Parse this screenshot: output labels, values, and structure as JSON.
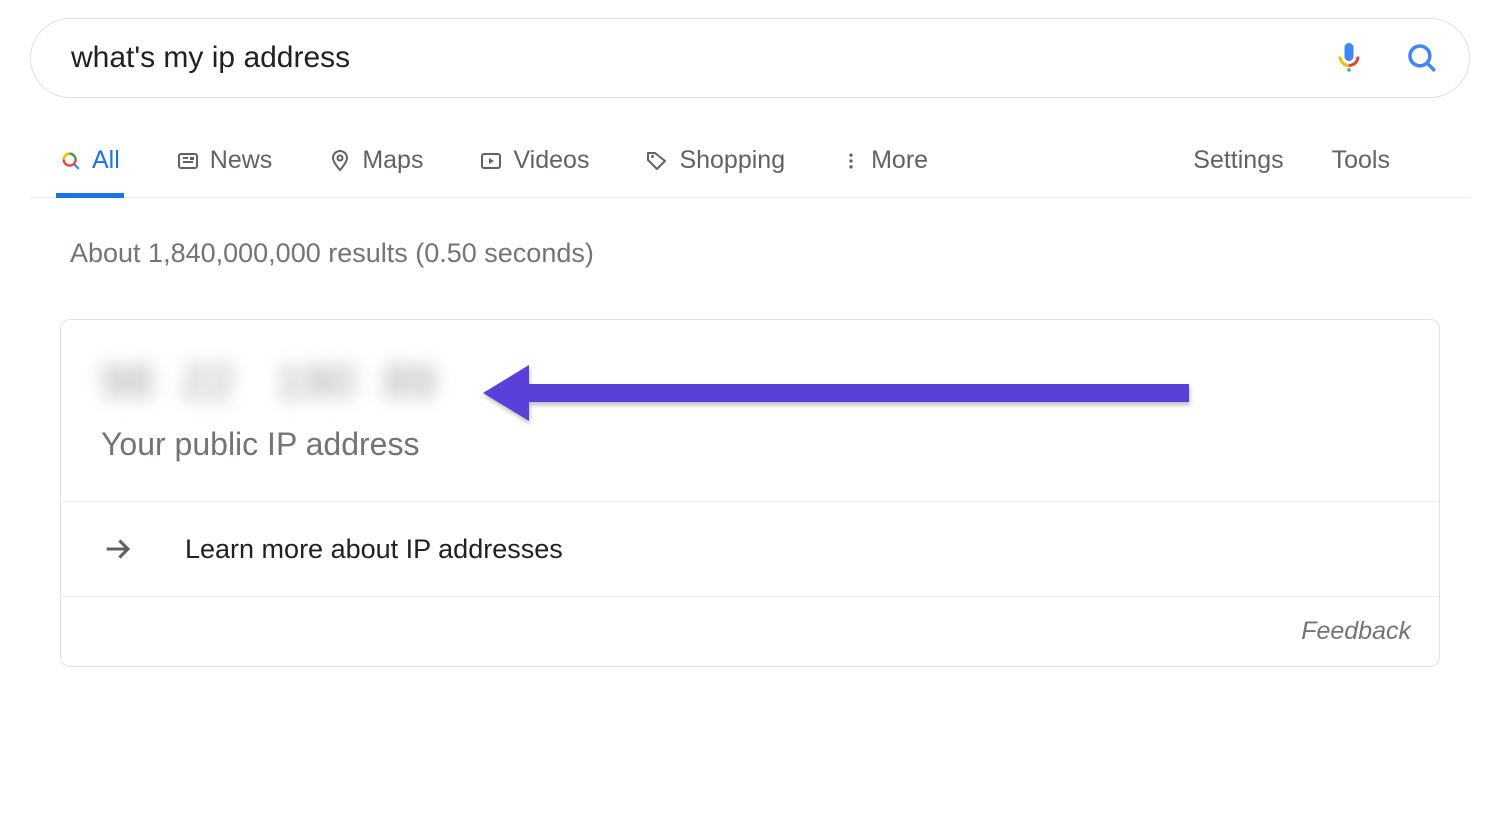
{
  "search": {
    "query": "what's my ip address"
  },
  "tabs": {
    "all": "All",
    "news": "News",
    "maps": "Maps",
    "videos": "Videos",
    "shopping": "Shopping",
    "more": "More"
  },
  "right_links": {
    "settings": "Settings",
    "tools": "Tools"
  },
  "result_stats": "About 1,840,000,000 results (0.50 seconds)",
  "ip_card": {
    "value": "98  22   190  89",
    "label": "Your public IP address",
    "learn_more": "Learn more about IP addresses",
    "feedback": "Feedback"
  }
}
